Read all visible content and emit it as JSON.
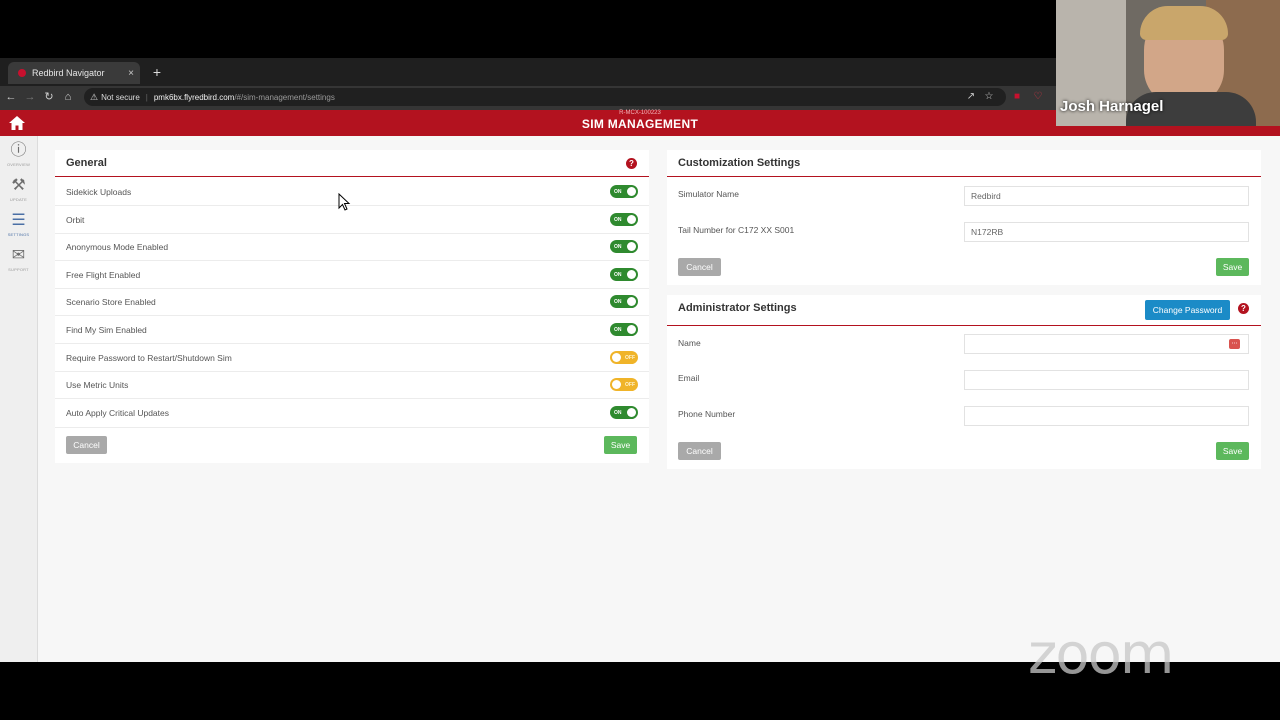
{
  "browser": {
    "tab_title": "Redbird Navigator",
    "tab_close": "×",
    "new_tab": "+",
    "security": "Not secure",
    "url_host": "pmk6bx.flyredbird.com",
    "url_path": "/#/sim-management/settings"
  },
  "header": {
    "serial": "R-MCX-100223",
    "title": "SIM MANAGEMENT"
  },
  "sidenav": {
    "items": [
      {
        "label": "OVERVIEW",
        "icon": "info-icon"
      },
      {
        "label": "UPDATE",
        "icon": "hammer-icon"
      },
      {
        "label": "SETTINGS",
        "icon": "sliders-icon"
      },
      {
        "label": "SUPPORT",
        "icon": "mail-icon"
      }
    ]
  },
  "general": {
    "title": "General",
    "help": "?",
    "settings": [
      {
        "label": "Sidekick Uploads",
        "state": "ON"
      },
      {
        "label": "Orbit",
        "state": "ON"
      },
      {
        "label": "Anonymous Mode Enabled",
        "state": "ON"
      },
      {
        "label": "Free Flight Enabled",
        "state": "ON"
      },
      {
        "label": "Scenario Store Enabled",
        "state": "ON"
      },
      {
        "label": "Find My Sim Enabled",
        "state": "ON"
      },
      {
        "label": "Require Password to Restart/Shutdown Sim",
        "state": "OFF"
      },
      {
        "label": "Use Metric Units",
        "state": "OFF"
      },
      {
        "label": "Auto Apply Critical Updates",
        "state": "ON"
      }
    ],
    "cancel": "Cancel",
    "save": "Save"
  },
  "customization": {
    "title": "Customization Settings",
    "simulator_name_label": "Simulator Name",
    "simulator_name_value": "Redbird",
    "tail_number_label": "Tail Number for C172 XX S001",
    "tail_number_value": "N172RB",
    "cancel": "Cancel",
    "save": "Save"
  },
  "administrator": {
    "title": "Administrator Settings",
    "change_password": "Change Password",
    "help": "?",
    "name_label": "Name",
    "name_value": "",
    "email_label": "Email",
    "email_value": "",
    "phone_label": "Phone Number",
    "phone_value": "",
    "cancel": "Cancel",
    "save": "Save"
  },
  "overlay": {
    "participant_name": "Josh Harnagel",
    "watermark": "zoom"
  },
  "colors": {
    "brand_red": "#b3121f",
    "toggle_on": "#2f8a2f",
    "toggle_off": "#f0b429",
    "save_green": "#5cb85c",
    "action_blue": "#1b8bc7"
  }
}
